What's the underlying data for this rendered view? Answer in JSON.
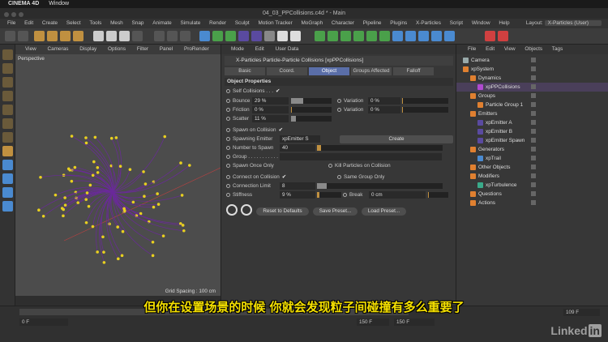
{
  "mac_menu": {
    "app": "CINEMA 4D",
    "window": "Window"
  },
  "window_title": "04_03_PPCollisions.c4d * - Main",
  "menu": [
    "File",
    "Edit",
    "Create",
    "Select",
    "Tools",
    "Mesh",
    "Snap",
    "Animate",
    "Simulate",
    "Render",
    "Sculpt",
    "Motion Tracker",
    "MoGraph",
    "Character",
    "Pipeline",
    "Plugins",
    "X-Particles",
    "Script",
    "Window",
    "Help"
  ],
  "layout": {
    "label": "Layout:",
    "value": "X-Particles (User)"
  },
  "viewport": {
    "menu": [
      "View",
      "Cameras",
      "Display",
      "Options",
      "Filter",
      "Panel",
      "ProRender"
    ],
    "label": "Perspective",
    "grid": "Grid Spacing : 100 cm"
  },
  "attr": {
    "menu": [
      "Mode",
      "Edit",
      "User Data"
    ],
    "header": "X-Particles Particle-Particle Collisions [xpPPCollisions]",
    "tabs": [
      "Basic",
      "Coord.",
      "Object",
      "Groups Affected",
      "Falloff"
    ],
    "active_tab": "Object",
    "section": "Object Properties",
    "self_collisions": "Self Collisions . . .",
    "bounce": {
      "label": "Bounce",
      "value": "29 %",
      "fill": 0.29
    },
    "bounce_var": {
      "label": "Variation",
      "value": "0 %"
    },
    "friction": {
      "label": "Friction",
      "value": "0 %"
    },
    "friction_var": {
      "label": "Variation",
      "value": "0 %"
    },
    "scatter": {
      "label": "Scatter",
      "value": "11 %",
      "fill": 0.11
    },
    "spawn_on_collision": "Spawn on Collision",
    "spawning_emitter": {
      "label": "Spawning Emitter",
      "value": "xpEmitter S"
    },
    "create": "Create",
    "number_to_spawn": {
      "label": "Number to Spawn",
      "value": "40"
    },
    "group": "Group . . . . . . . . . . .",
    "spawn_once": "Spawn Once Only",
    "kill_particles": "Kill Particles on Collision",
    "connect": "Connect on Collision",
    "same_group": "Same Group Only",
    "connection_limit": {
      "label": "Connection Limit",
      "value": "8"
    },
    "stiffness": {
      "label": "Stiffness",
      "value": "9 %"
    },
    "break": {
      "label": "Break",
      "value": "0 cm"
    },
    "buttons": [
      "Reset to Defaults",
      "Save Preset...",
      "Load Preset..."
    ]
  },
  "objects": {
    "menu": [
      "File",
      "Edit",
      "View",
      "Objects",
      "Tags"
    ],
    "items": [
      {
        "label": "Camera",
        "color": "#9aa"
      },
      {
        "label": "xpSystem",
        "color": "#e08030"
      },
      {
        "label": "Dynamics",
        "color": "#e08030"
      },
      {
        "label": "xpPPCollisions",
        "color": "#b04ad0"
      },
      {
        "label": "Groups",
        "color": "#e08030"
      },
      {
        "label": "Particle Group 1",
        "color": "#e08030"
      },
      {
        "label": "Emitters",
        "color": "#e08030"
      },
      {
        "label": "xpEmitter A",
        "color": "#5a4aa0"
      },
      {
        "label": "xpEmitter B",
        "color": "#5a4aa0"
      },
      {
        "label": "xpEmitter Spawn",
        "color": "#5a4aa0"
      },
      {
        "label": "Generators",
        "color": "#e08030"
      },
      {
        "label": "xpTrail",
        "color": "#4a8ad0"
      },
      {
        "label": "Other Objects",
        "color": "#e08030"
      },
      {
        "label": "Modifiers",
        "color": "#e08030"
      },
      {
        "label": "xpTurbulence",
        "color": "#3aaa8a"
      },
      {
        "label": "Questions",
        "color": "#e08030"
      },
      {
        "label": "Actions",
        "color": "#e08030"
      }
    ]
  },
  "timeline": {
    "start": "0 F",
    "end": "150 F",
    "end2": "150 F",
    "frame": "109 F"
  },
  "subtitle": "但你在设置场景的时候 你就会发现粒子间碰撞有多么重要了",
  "watermark": "Linked"
}
